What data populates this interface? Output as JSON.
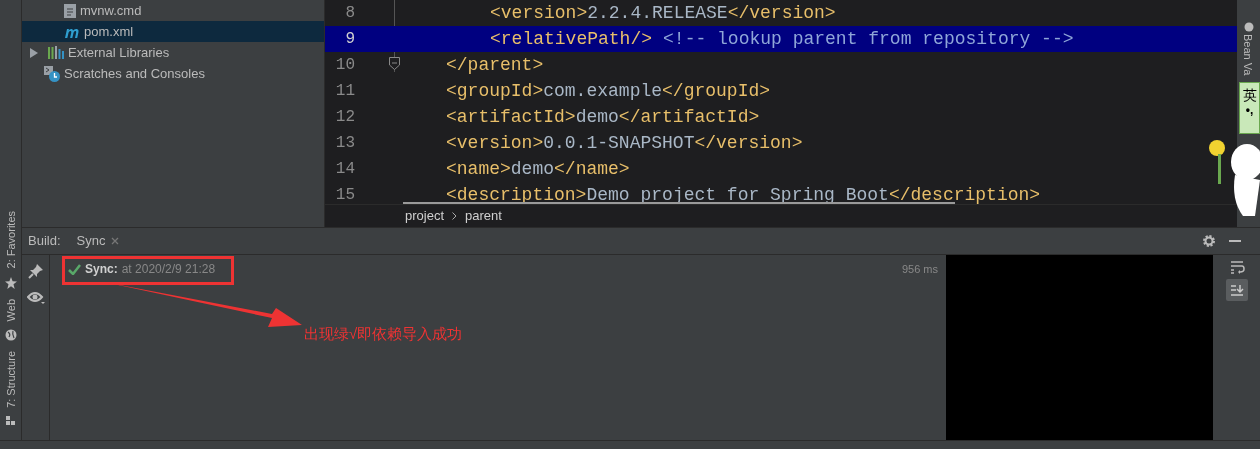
{
  "left_tool_tabs": [
    {
      "label": "2: Favorites",
      "kind": "star"
    },
    {
      "label": "Web",
      "kind": "globe"
    },
    {
      "label": "7: Structure",
      "kind": "structure"
    }
  ],
  "project_tree": [
    {
      "label": "mvnw.cmd",
      "kind": "file",
      "selected": false
    },
    {
      "label": "pom.xml",
      "kind": "maven",
      "selected": true
    },
    {
      "label": "External Libraries",
      "kind": "libraries",
      "selected": false
    },
    {
      "label": "Scratches and Consoles",
      "kind": "scratches",
      "selected": false
    }
  ],
  "editor": {
    "lines": [
      {
        "number": "8",
        "kind": "inner",
        "selected": false,
        "tokens": [
          {
            "kind": "tag",
            "text": "<version>"
          },
          {
            "kind": "text",
            "text": "2.2.4.RELEASE"
          },
          {
            "kind": "tag",
            "text": "</version>"
          }
        ]
      },
      {
        "number": "9",
        "kind": "inner",
        "selected": true,
        "tokens": [
          {
            "kind": "tag",
            "text": "<relativePath/>"
          },
          {
            "kind": "comment",
            "text": "<!-- lookup parent from repository -->"
          }
        ]
      },
      {
        "number": "10",
        "kind": "outer",
        "selected": false,
        "tokens": [
          {
            "kind": "tag",
            "text": "</parent>"
          }
        ]
      },
      {
        "number": "11",
        "kind": "outer",
        "selected": false,
        "tokens": [
          {
            "kind": "tag",
            "text": "<groupId>"
          },
          {
            "kind": "text",
            "text": "com.example"
          },
          {
            "kind": "tag",
            "text": "</groupId>"
          }
        ]
      },
      {
        "number": "12",
        "kind": "outer",
        "selected": false,
        "tokens": [
          {
            "kind": "tag",
            "text": "<artifactId>"
          },
          {
            "kind": "text",
            "text": "demo"
          },
          {
            "kind": "tag",
            "text": "</artifactId>"
          }
        ]
      },
      {
        "number": "13",
        "kind": "outer",
        "selected": false,
        "tokens": [
          {
            "kind": "tag",
            "text": "<version>"
          },
          {
            "kind": "text",
            "text": "0.0.1-SNAPSHOT"
          },
          {
            "kind": "tag",
            "text": "</version>"
          }
        ]
      },
      {
        "number": "14",
        "kind": "outer",
        "selected": false,
        "tokens": [
          {
            "kind": "tag",
            "text": "<name>"
          },
          {
            "kind": "text",
            "text": "demo"
          },
          {
            "kind": "tag",
            "text": "</name>"
          }
        ]
      },
      {
        "number": "15",
        "kind": "outer",
        "selected": false,
        "tokens": [
          {
            "kind": "tag",
            "text": "<description>"
          },
          {
            "kind": "text",
            "text": "Demo project for Spring Boot"
          },
          {
            "kind": "tag",
            "text": "</description>"
          }
        ]
      }
    ],
    "breadcrumbs": [
      "project",
      "parent"
    ]
  },
  "right_tool_tab": "Bean Va",
  "ime_badge": {
    "label": "英",
    "punctuation": "•,"
  },
  "build": {
    "title": "Build:",
    "tabs": [
      {
        "label": "Sync",
        "selected": true
      }
    ],
    "rows": [
      {
        "name": "Sync:",
        "detail": "at 2020/2/9 21:28",
        "duration": "956 ms"
      }
    ]
  },
  "annotation": {
    "text": "出现绿√即依赖导入成功"
  }
}
